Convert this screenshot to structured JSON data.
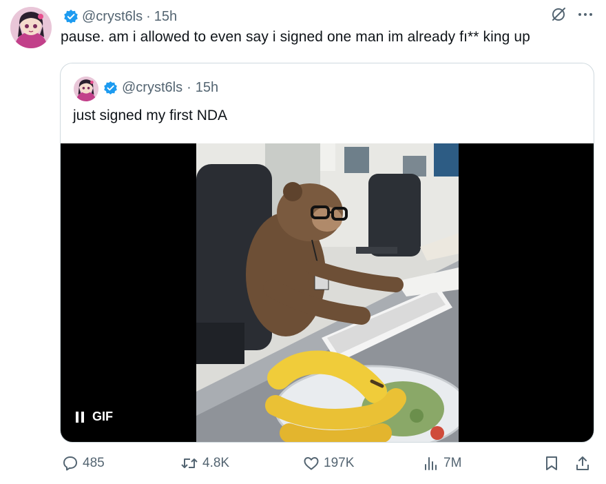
{
  "tweet": {
    "handle": "@cryst6ls",
    "separator": "·",
    "time": "15h",
    "text": "pause. am i allowed to even say i signed one man im already fı** king up"
  },
  "quoted": {
    "handle": "@cryst6ls",
    "separator": "·",
    "time": "15h",
    "text": "just signed my first NDA",
    "media": {
      "badge": "GIF",
      "icon": "pause-icon"
    }
  },
  "actions": {
    "replies": "485",
    "reposts": "4.8K",
    "likes": "197K",
    "views": "7M"
  },
  "icons": {
    "verified": "verified-badge-icon",
    "grok": "grok-icon",
    "more": "more-icon",
    "reply": "reply-icon",
    "repost": "repost-icon",
    "like": "heart-icon",
    "views": "views-icon",
    "bookmark": "bookmark-icon",
    "share": "share-icon"
  },
  "colors": {
    "verified": "#1d9bf0",
    "muted": "#536471",
    "text": "#0f1419",
    "border": "#cfd9de"
  }
}
